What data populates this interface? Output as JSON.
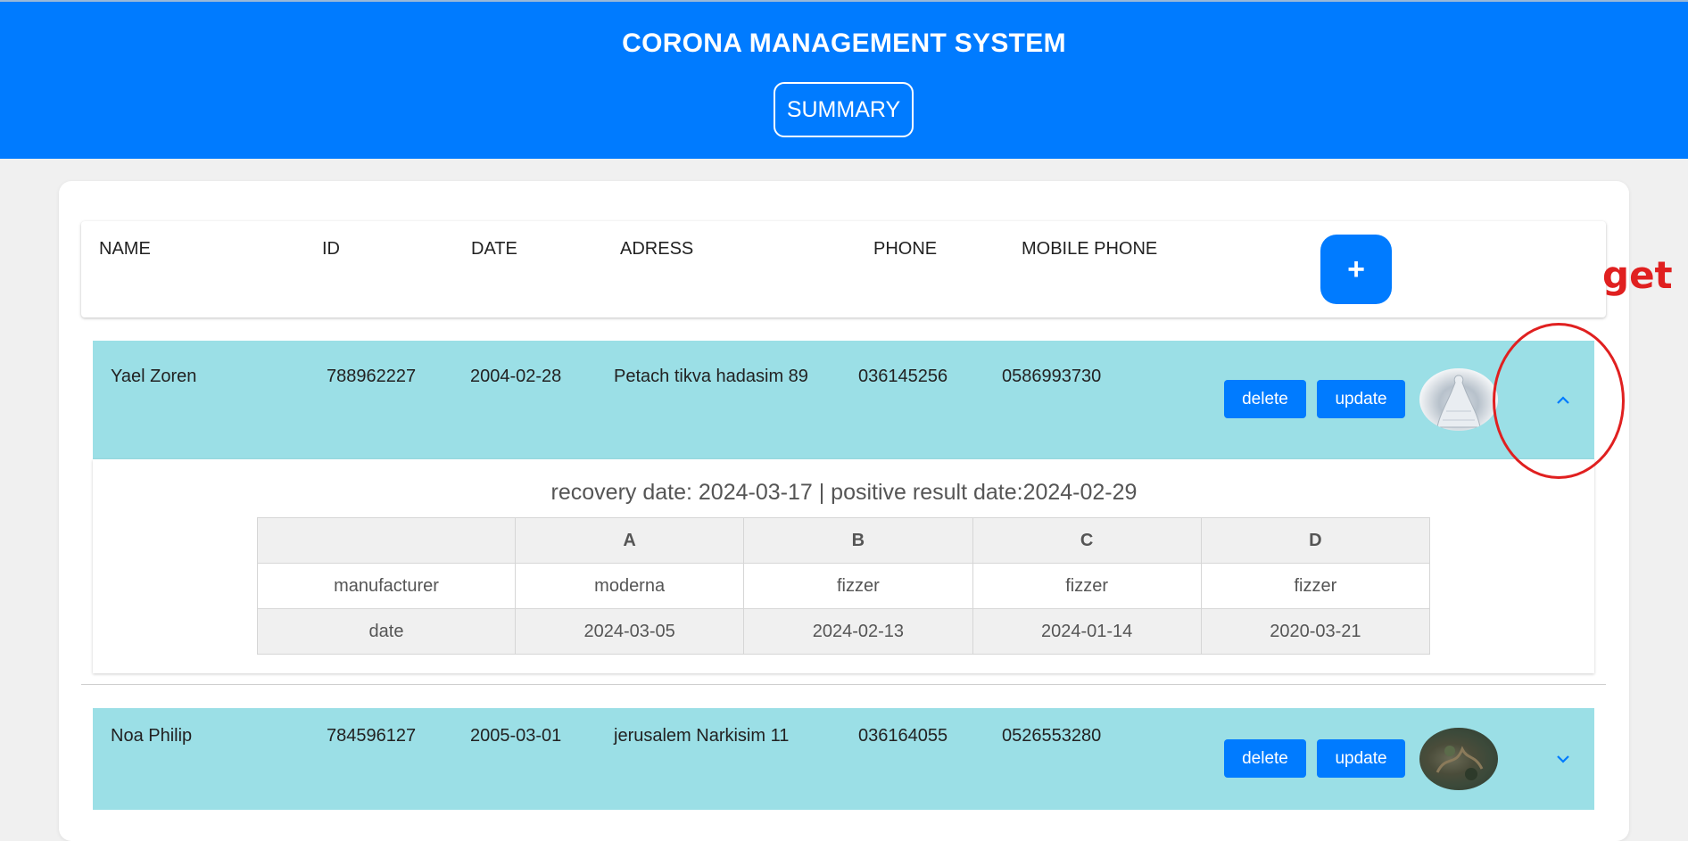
{
  "header": {
    "title": "CORONA MANAGEMENT SYSTEM",
    "summary_label": "SUMMARY"
  },
  "table_header": {
    "columns": [
      "NAME",
      "ID",
      "DATE",
      "ADRESS",
      "PHONE",
      "MOBILE PHONE"
    ],
    "add_label": "+"
  },
  "rows": [
    {
      "name": "Yael Zoren",
      "id": "788962227",
      "date": "2004-02-28",
      "address": "Petach tikva hadasim 89",
      "phone": "036145256",
      "mobile": "0586993730",
      "delete_label": "delete",
      "update_label": "update",
      "expanded": true,
      "chevron": "chevron-up-icon"
    },
    {
      "name": "Noa Philip",
      "id": "784596127",
      "date": "2005-03-01",
      "address": "jerusalem Narkisim 11",
      "phone": "036164055",
      "mobile": "0526553280",
      "delete_label": "delete",
      "update_label": "update",
      "expanded": false,
      "chevron": "chevron-down-icon"
    }
  ],
  "details": {
    "summary": "recovery date: 2024-03-17 | positive result date:2024-02-29",
    "vaccine_table": {
      "headers": [
        "",
        "A",
        "B",
        "C",
        "D"
      ],
      "manufacturer_label": "manufacturer",
      "manufacturers": [
        "moderna",
        "fizzer",
        "fizzer",
        "fizzer"
      ],
      "date_label": "date",
      "dates": [
        "2024-03-05",
        "2024-02-13",
        "2024-01-14",
        "2020-03-21"
      ]
    }
  },
  "annotation": {
    "text": "get",
    "color": "#e02020"
  },
  "colors": {
    "primary": "#007bff",
    "row_background": "#9bdfe6",
    "page_background": "#f0f0f0"
  }
}
